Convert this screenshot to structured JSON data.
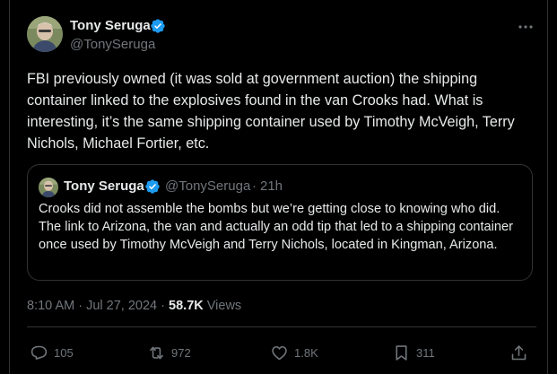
{
  "author": {
    "name": "Tony Seruga",
    "handle": "@TonySeruga",
    "verified": true
  },
  "tweet": {
    "text": "FBI previously owned (it was sold at government auction) the shipping container linked to the explosives found in the van Crooks had. What is interesting, it’s the same shipping container used by Timothy McVeigh, Terry Nichols, Michael Fortier, etc.",
    "time": "8:10 AM",
    "date": "Jul 27, 2024",
    "views": "58.7K",
    "views_label": "Views"
  },
  "quote": {
    "name": "Tony Seruga",
    "handle": "@TonySeruga",
    "separator": "·",
    "time": "21h",
    "text": "Crooks did not assemble the bombs but we’re getting close to knowing who did. The link to Arizona, the van and actually an odd tip that led to a shipping container once used by Timothy McVeigh and Terry Nichols, located in Kingman, Arizona."
  },
  "meta_separator": "·",
  "actions": {
    "replies": "105",
    "reposts": "972",
    "likes": "1.8K",
    "bookmarks": "311"
  },
  "icons": {
    "verified": "verified-badge-icon",
    "more": "more-icon",
    "reply": "reply-icon",
    "repost": "repost-icon",
    "like": "heart-icon",
    "bookmark": "bookmark-icon",
    "share": "share-icon"
  },
  "colors": {
    "background": "#000000",
    "text": "#e7e9ea",
    "secondary": "#71767b",
    "border": "#2f3336",
    "verified": "#1d9bf0"
  }
}
